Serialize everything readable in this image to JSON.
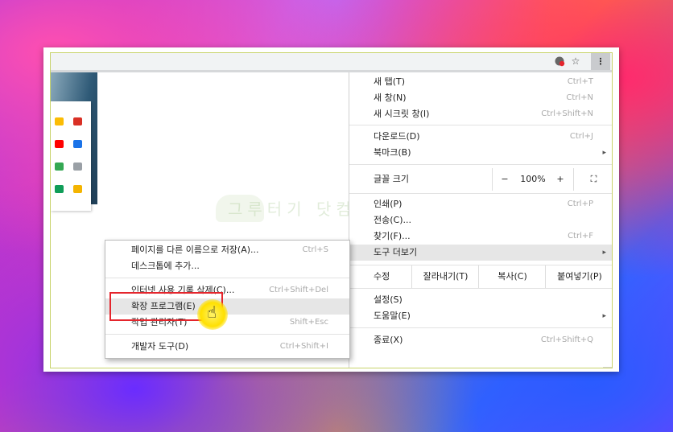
{
  "toolbar": {
    "extension_icon": "extension-icon",
    "star_icon": "☆",
    "menu_icon": "⋮"
  },
  "watermark": "그루터기 닷컴",
  "menu": {
    "new_tab": {
      "label": "새 탭(T)",
      "shortcut": "Ctrl+T"
    },
    "new_window": {
      "label": "새 창(N)",
      "shortcut": "Ctrl+N"
    },
    "new_incognito": {
      "label": "새 시크릿 창(I)",
      "shortcut": "Ctrl+Shift+N"
    },
    "downloads": {
      "label": "다운로드(D)",
      "shortcut": "Ctrl+J"
    },
    "bookmarks": {
      "label": "북마크(B)",
      "arrow": "▸"
    },
    "zoom": {
      "label": "글꼴 크기",
      "minus": "−",
      "value": "100%",
      "plus": "+",
      "fullscreen": "⛶"
    },
    "print": {
      "label": "인쇄(P)",
      "shortcut": "Ctrl+P"
    },
    "cast": {
      "label": "전송(C)..."
    },
    "find": {
      "label": "찾기(F)...",
      "shortcut": "Ctrl+F"
    },
    "more_tools": {
      "label": "도구 더보기",
      "arrow": "▸"
    },
    "edit": {
      "label": "수정",
      "cut": "잘라내기(T)",
      "copy": "복사(C)",
      "paste": "붙여넣기(P)"
    },
    "settings": {
      "label": "설정(S)"
    },
    "help": {
      "label": "도움말(E)",
      "arrow": "▸"
    },
    "exit": {
      "label": "종료(X)",
      "shortcut": "Ctrl+Shift+Q"
    }
  },
  "submenu": {
    "save_page": {
      "label": "페이지를 다른 이름으로 저장(A)...",
      "shortcut": "Ctrl+S"
    },
    "add_desktop": {
      "label": "데스크톱에 추가..."
    },
    "clear_history": {
      "label": "인터넷 사용 기록 삭제(C)...",
      "shortcut": "Ctrl+Shift+Del"
    },
    "extensions": {
      "label": "확장 프로그램(E)"
    },
    "task_manager": {
      "label": "작업 관리자(T)",
      "shortcut": "Shift+Esc"
    },
    "dev_tools": {
      "label": "개발자 도구(D)",
      "shortcut": "Ctrl+Shift+I"
    }
  },
  "colors": {
    "highlight": "#e6e6e6",
    "annotation": "#e4252c",
    "cursor_glow": "#ffe000"
  }
}
